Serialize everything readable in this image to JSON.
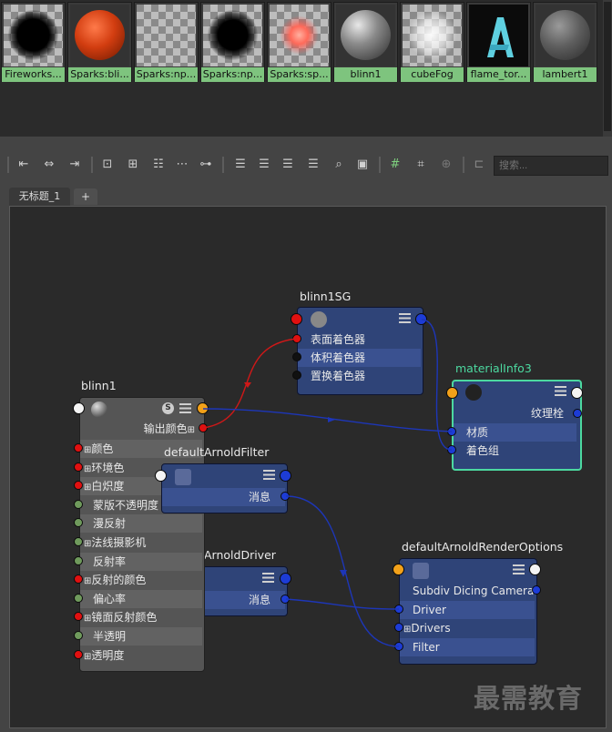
{
  "swatches": [
    {
      "label": "Fireworks..."
    },
    {
      "label": "Sparks:bli..."
    },
    {
      "label": "Sparks:np..."
    },
    {
      "label": "Sparks:np..."
    },
    {
      "label": "Sparks:sp..."
    },
    {
      "label": "blinn1"
    },
    {
      "label": "cubeFog"
    },
    {
      "label": "flame_tor..."
    },
    {
      "label": "lambert1"
    }
  ],
  "search": {
    "placeholder": "搜索..."
  },
  "tabs": {
    "active": "无标题_1",
    "add": "+"
  },
  "colors": {
    "port_red": "#e01010",
    "port_blue": "#1d3cd6",
    "port_orange": "#f2a11a",
    "selected_outline": "#4cd9a0",
    "swatch_label_bg": "#7ec47e"
  },
  "nodes": {
    "blinn1SG": {
      "title": "blinn1SG",
      "rows": [
        "表面着色器",
        "体积着色器",
        "置换着色器"
      ]
    },
    "materialInfo3": {
      "title": "materialInfo3",
      "rows": [
        "纹理栓",
        "材质",
        "着色组"
      ]
    },
    "blinn1": {
      "title": "blinn1",
      "output": "输出颜色",
      "rows": [
        "颜色",
        "环境色",
        "白炽度",
        "蒙版不透明度",
        "漫反射",
        "法线摄影机",
        "反射率",
        "反射的颜色",
        "偏心率",
        "镜面反射颜色",
        "半透明",
        "透明度"
      ]
    },
    "defaultArnoldFilter": {
      "title": "defaultArnoldFilter",
      "rows": [
        "消息"
      ]
    },
    "defaultArnoldDriver": {
      "title": "ArnoldDriver",
      "rows": [
        "消息"
      ]
    },
    "defaultArnoldRenderOptions": {
      "title": "defaultArnoldRenderOptions",
      "rows": [
        "Subdiv Dicing Camera",
        "Driver",
        "Drivers",
        "Filter"
      ]
    }
  },
  "watermark": "最需教育",
  "icons": [
    "swatch-thumbnail",
    "toolbar-layout-icons",
    "search-icon",
    "grid-icon",
    "node-menu-icon",
    "shading-group-icon",
    "arnold-icon"
  ]
}
